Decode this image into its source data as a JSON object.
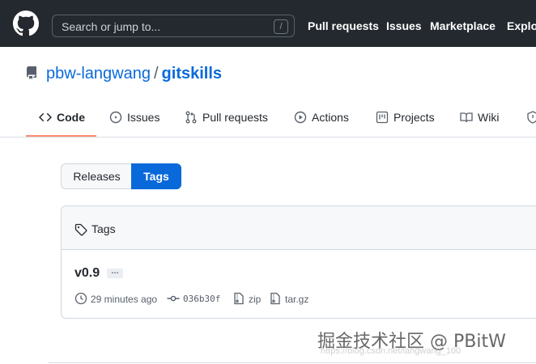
{
  "header": {
    "search_placeholder": "Search or jump to...",
    "slash_key": "/",
    "nav": [
      "Pull requests",
      "Issues",
      "Marketplace",
      "Explore"
    ]
  },
  "repo": {
    "owner": "pbw-langwang",
    "separator": "/",
    "name": "gitskills"
  },
  "tabs": [
    {
      "label": "Code",
      "icon": "code-icon",
      "selected": true
    },
    {
      "label": "Issues",
      "icon": "issue-opened-icon"
    },
    {
      "label": "Pull requests",
      "icon": "git-pull-request-icon"
    },
    {
      "label": "Actions",
      "icon": "play-icon"
    },
    {
      "label": "Projects",
      "icon": "project-icon"
    },
    {
      "label": "Wiki",
      "icon": "book-icon"
    },
    {
      "label": "",
      "icon": "shield-icon"
    }
  ],
  "releases_toggle": {
    "releases": "Releases",
    "tags": "Tags",
    "selected": "Tags"
  },
  "tags_box": {
    "header": "Tags",
    "items": [
      {
        "name": "v0.9",
        "ellipsis": "…",
        "time": "29 minutes ago",
        "commit": "036b30f",
        "zip": "zip",
        "targz": "tar.gz"
      }
    ]
  },
  "watermark": {
    "main": "掘金技术社区 @ PBitW",
    "sub": "https://blog.csdn.net/langwang_100"
  },
  "colors": {
    "header_bg": "#24292f",
    "link": "#0969da",
    "selected_tab_underline": "#fd8c73",
    "tags_button_bg": "#0969da"
  }
}
